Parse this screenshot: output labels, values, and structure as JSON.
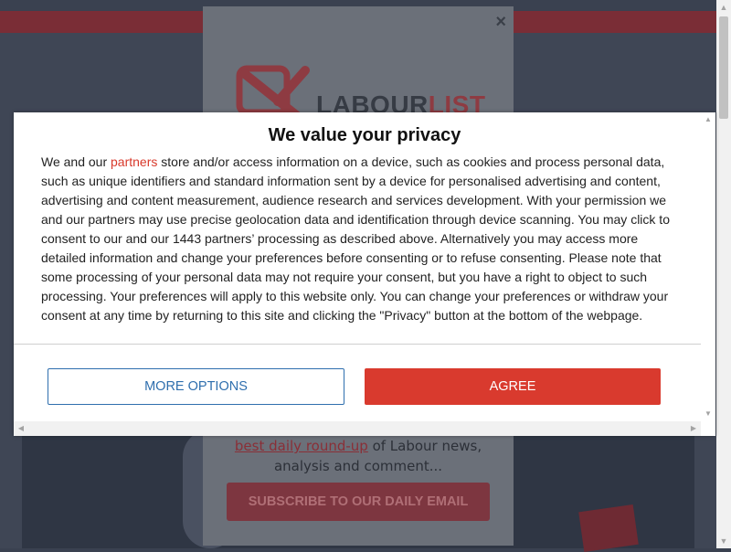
{
  "site": {
    "logo": {
      "word_a": "LABOUR",
      "word_b": "LIST"
    },
    "popup": {
      "close_glyph": "×",
      "line1_link": "best daily round-up",
      "line1_rest": " of Labour news,",
      "line2": "analysis and comment...",
      "subscribe_label": "SUBSCRIBE TO OUR DAILY EMAIL"
    }
  },
  "consent": {
    "title": "We value your privacy",
    "body_prefix": "We and our ",
    "partners_link": "partners",
    "body_rest": " store and/or access information on a device, such as cookies and process personal data, such as unique identifiers and standard information sent by a device for personalised advertising and content, advertising and content measurement, audience research and services development. With your permission we and our partners may use precise geolocation data and identification through device scanning. You may click to consent to our and our 1443 partners’ processing as described above. Alternatively you may access more detailed information and change your preferences before consenting or to refuse consenting. Please note that some processing of your personal data may not require your consent, but you have a right to object to such processing. Your preferences will apply to this website only. You can change your preferences or withdraw your consent at any time by returning to this site and clicking the \"Privacy\" button at the bottom of the webpage.",
    "more_options_label": "MORE OPTIONS",
    "agree_label": "AGREE"
  },
  "icons": {
    "up": "▲",
    "down": "▼",
    "left": "◀",
    "right": "▶"
  },
  "colors": {
    "accent_red": "#d93a2e",
    "link_blue": "#2f6fae",
    "brand_maroon": "#8e3b42"
  }
}
